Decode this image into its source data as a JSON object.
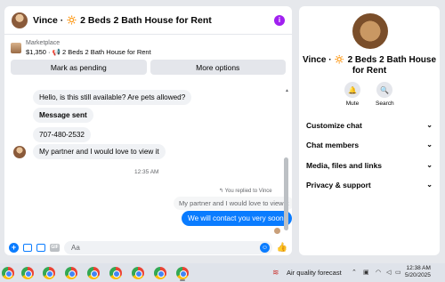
{
  "chat": {
    "title": "Vince · 🔅 2 Beds 2 Bath House for Rent",
    "listing": {
      "label": "Marketplace",
      "price_line": "$1,350 · 📢 2 Beds 2 Bath House for Rent",
      "mark_pending": "Mark as pending",
      "more_options": "More options"
    },
    "messages": [
      {
        "text": "Hello, is this still available? Are pets allowed?",
        "from": "me"
      },
      {
        "text": "Message sent",
        "from": "me"
      },
      {
        "text": "707-480-2532",
        "from": "me"
      },
      {
        "text": "My partner and I would love to view it",
        "from": "them"
      }
    ],
    "timestamp": "12:35 AM",
    "reply_note": "You replied to Vince",
    "replied_quote": "My partner and I would love to view it",
    "my_reply": "We will contact you very soon.",
    "composer_placeholder": "Aa"
  },
  "info": {
    "name": "Vince · 🔅 2 Beds 2 Bath House for Rent",
    "mute_label": "Mute",
    "search_label": "Search",
    "sections": [
      "Customize chat",
      "Chat members",
      "Media, files and links",
      "Privacy & support"
    ]
  },
  "taskbar": {
    "air_quality": "Air quality forecast",
    "time": "12:38 AM",
    "date": "5/20/2025"
  },
  "colors": {
    "accent": "#0a7cff",
    "info_button": "#a020f0"
  }
}
